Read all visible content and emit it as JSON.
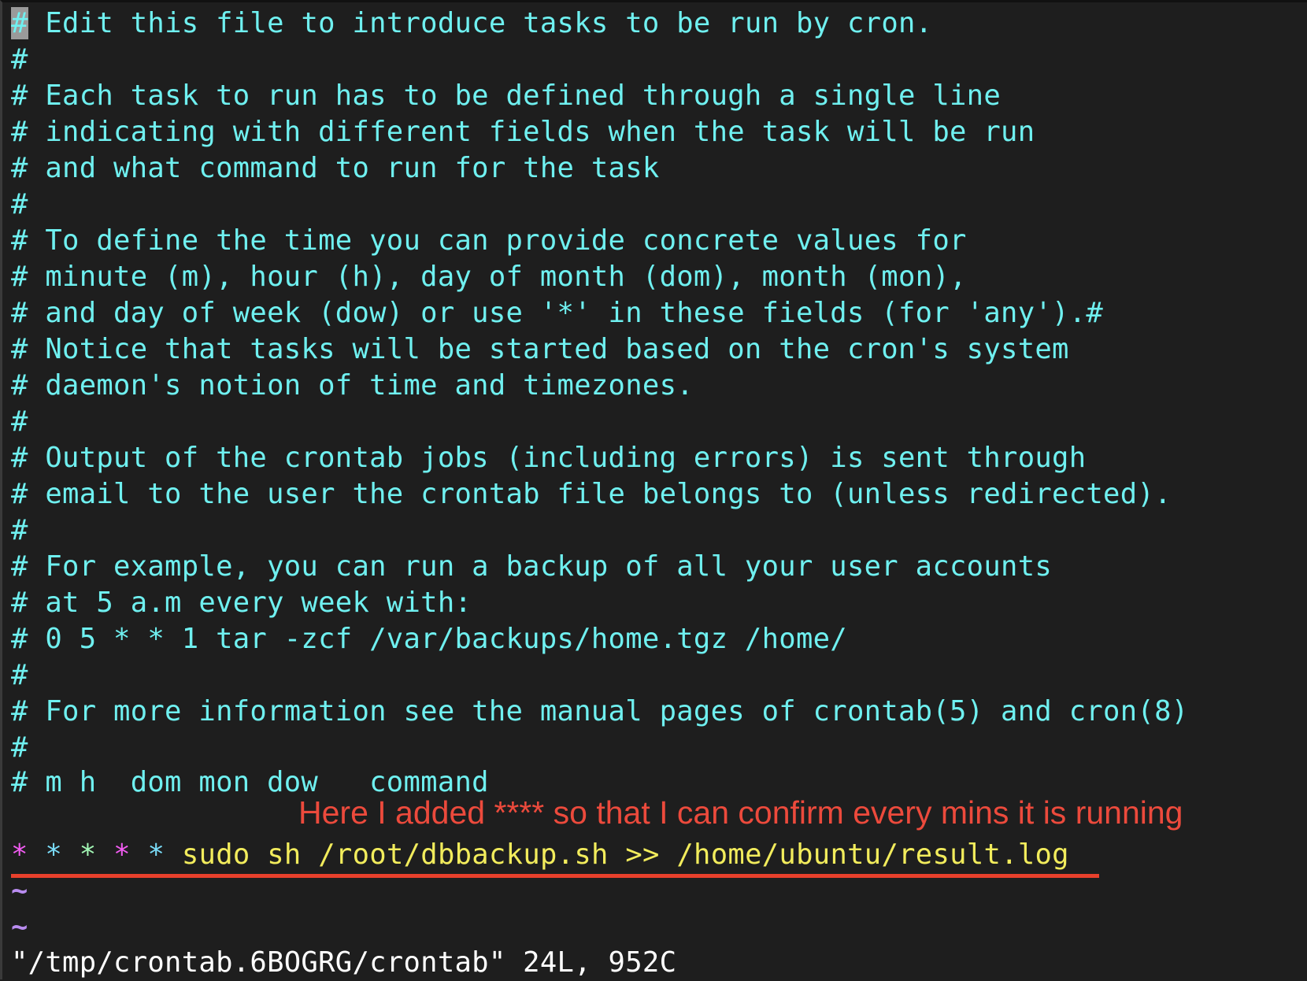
{
  "editor": {
    "cursor_char": "#",
    "first_line_rest": " Edit this file to introduce tasks to be run by cron.",
    "comment_lines": [
      "#",
      "# Each task to run has to be defined through a single line",
      "# indicating with different fields when the task will be run",
      "# and what command to run for the task",
      "#",
      "# To define the time you can provide concrete values for",
      "# minute (m), hour (h), day of month (dom), month (mon),",
      "# and day of week (dow) or use '*' in these fields (for 'any').#",
      "# Notice that tasks will be started based on the cron's system",
      "# daemon's notion of time and timezones.",
      "#",
      "# Output of the crontab jobs (including errors) is sent through",
      "# email to the user the crontab file belongs to (unless redirected).",
      "#",
      "# For example, you can run a backup of all your user accounts",
      "# at 5 a.m every week with:",
      "# 0 5 * * 1 tar -zcf /var/backups/home.tgz /home/",
      "#",
      "# For more information see the manual pages of crontab(5) and cron(8)",
      "#",
      "# m h  dom mon dow   command"
    ],
    "cron_entry": {
      "minute": "*",
      "hour": "*",
      "dom": "*",
      "month": "*",
      "dow": "*",
      "command": "sudo sh /root/dbbackup.sh >> /home/ubuntu/result.log"
    },
    "empty_line_marker": "~",
    "status_line": "\"/tmp/crontab.6BOGRG/crontab\" 24L, 952C"
  },
  "annotation": {
    "text": "Here I added **** so that I can confirm every mins it is running",
    "color": "#ec4a3c"
  },
  "colors": {
    "background": "#1e1e1e",
    "comment": "#6ff0f0",
    "command": "#f2ec5c",
    "asterisk_magenta": "#f25cf2",
    "asterisk_cyan": "#7adcf8",
    "asterisk_green": "#a3f7b5",
    "tilde": "#b98cf0",
    "underline": "#e8402c"
  }
}
